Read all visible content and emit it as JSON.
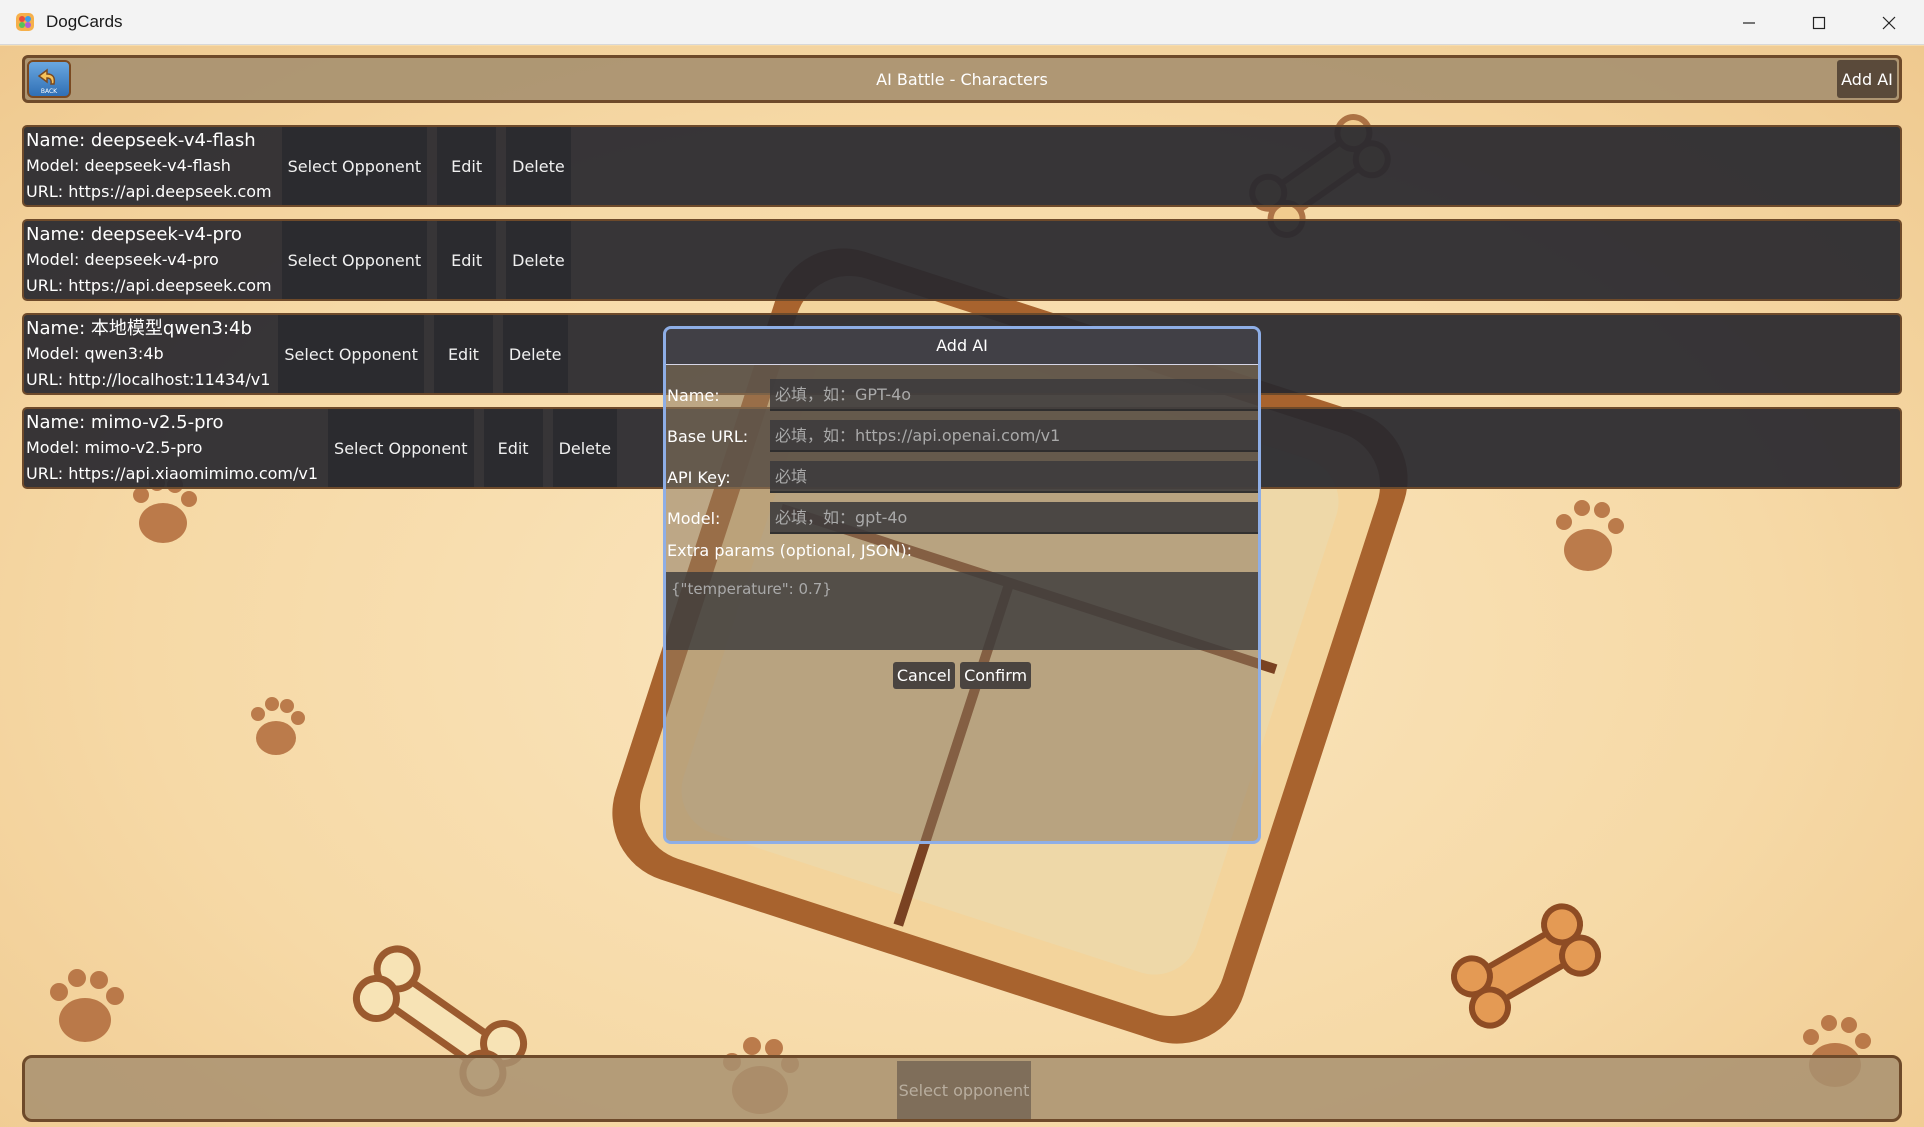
{
  "window": {
    "title": "DogCards",
    "controls": [
      "minimize-icon",
      "maximize-icon",
      "close-icon"
    ]
  },
  "topbar": {
    "title": "AI Battle - Characters",
    "back_icon": "back-arrow-icon",
    "back_label": "BACK",
    "add_ai_label": "Add AI"
  },
  "ai_list": [
    {
      "name": "Name: deepseek-v4-flash",
      "model": "Model: deepseek-v4-flash",
      "url": "URL: https://api.deepseek.com"
    },
    {
      "name": "Name: deepseek-v4-pro",
      "model": "Model: deepseek-v4-pro",
      "url": "URL: https://api.deepseek.com"
    },
    {
      "name": "Name: 本地模型qwen3:4b",
      "model": "Model: qwen3:4b",
      "url": "URL: http://localhost:11434/v1"
    },
    {
      "name": "Name: mimo-v2.5-pro",
      "model": "Model: mimo-v2.5-pro",
      "url": "URL: https://api.xiaomimimo.com/v1"
    }
  ],
  "row_buttons": {
    "select": "Select Opponent",
    "edit": "Edit",
    "delete": "Delete"
  },
  "dialog": {
    "title": "Add AI",
    "fields": {
      "name": {
        "label": "Name:",
        "placeholder": "必填，如：GPT-4o"
      },
      "base_url": {
        "label": "Base URL:",
        "placeholder": "必填，如：https://api.openai.com/v1"
      },
      "api_key": {
        "label": "API Key:",
        "placeholder": "必填"
      },
      "model": {
        "label": "Model:",
        "placeholder": "必填，如：gpt-4o"
      }
    },
    "extra_label": "Extra params (optional, JSON):",
    "extra_placeholder": "{\"temperature\": 0.7}",
    "cancel_label": "Cancel",
    "confirm_label": "Confirm"
  },
  "bottombar": {
    "select_opponent_label": "Select opponent"
  },
  "colors": {
    "background": "#f6dcad",
    "row_bg": "#28282e",
    "dialog_border": "#8eaee6",
    "bar_border": "#6e4a2a"
  }
}
